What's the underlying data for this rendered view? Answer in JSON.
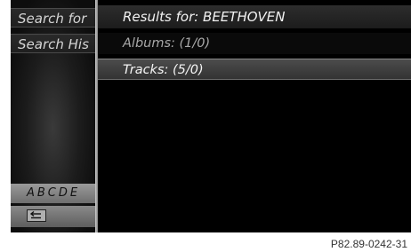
{
  "left_panel": {
    "items": [
      {
        "label": "Search for"
      },
      {
        "label": "Search His"
      }
    ],
    "keyboard_letters": "ABCDE",
    "back_icon": "back-arrow-icon"
  },
  "results": {
    "header": "Results for: BEETHOVEN",
    "rows": [
      {
        "label": "Albums: (1/0)"
      },
      {
        "label": "Tracks: (5/0)"
      }
    ]
  },
  "caption": "P82.89-0242-31",
  "colors": {
    "screen_bg": "#0b0b0b",
    "highlight_row": "#3f3f3f",
    "text_primary": "#f2f2f2",
    "text_dim": "#a8a8a8"
  }
}
